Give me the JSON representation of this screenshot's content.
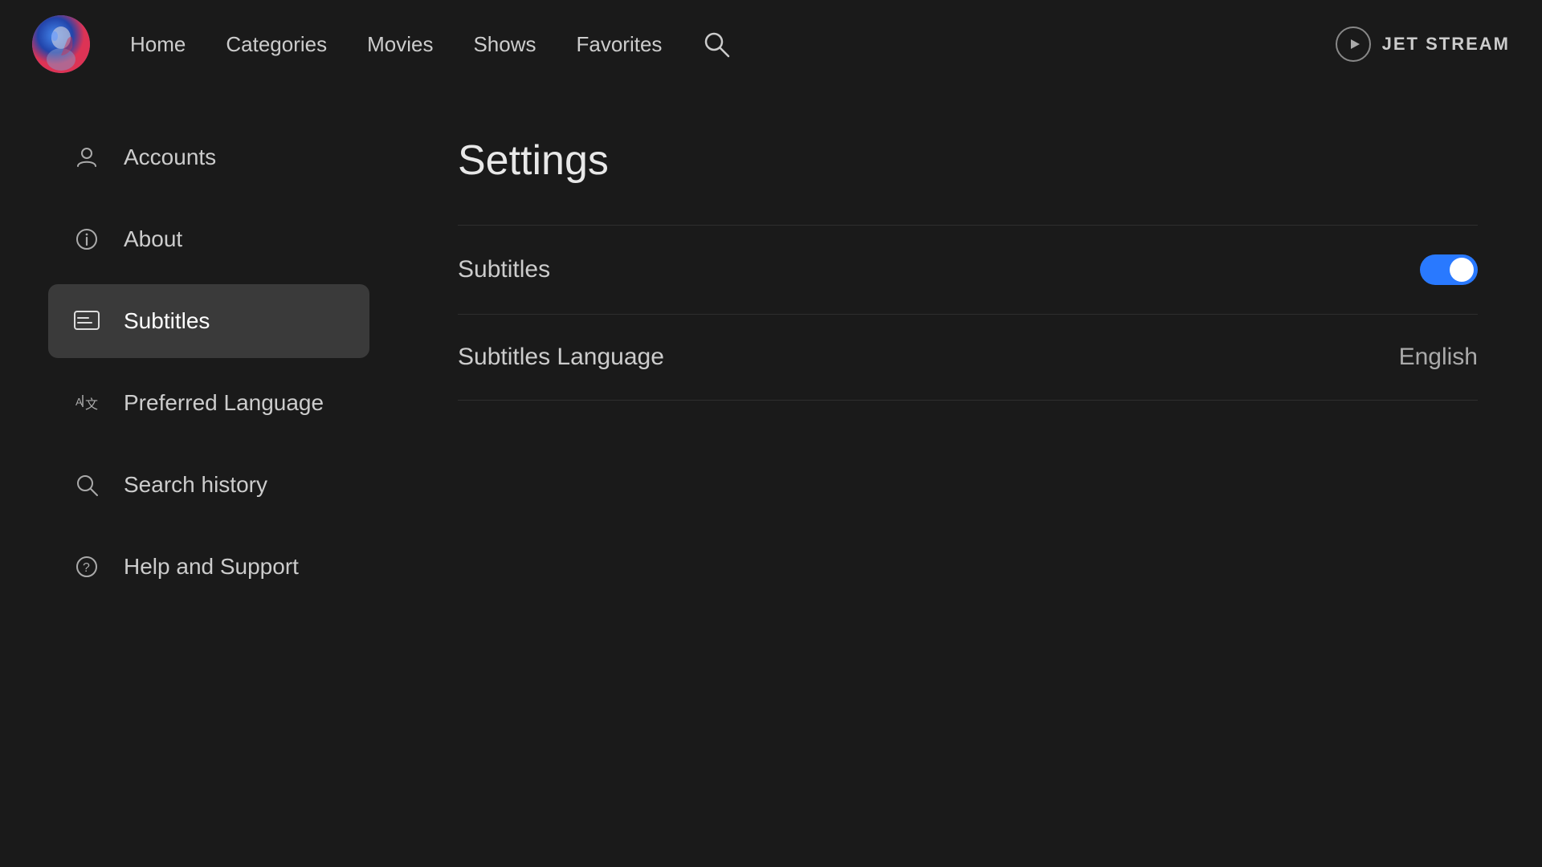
{
  "header": {
    "nav": [
      {
        "label": "Home",
        "id": "home"
      },
      {
        "label": "Categories",
        "id": "categories"
      },
      {
        "label": "Movies",
        "id": "movies"
      },
      {
        "label": "Shows",
        "id": "shows"
      },
      {
        "label": "Favorites",
        "id": "favorites"
      }
    ],
    "brand_name": "JET STREAM"
  },
  "sidebar": {
    "items": [
      {
        "id": "accounts",
        "label": "Accounts",
        "icon": "person"
      },
      {
        "id": "about",
        "label": "About",
        "icon": "info"
      },
      {
        "id": "subtitles",
        "label": "Subtitles",
        "icon": "subtitles",
        "active": true
      },
      {
        "id": "preferred-language",
        "label": "Preferred Language",
        "icon": "translate"
      },
      {
        "id": "search-history",
        "label": "Search history",
        "icon": "search"
      },
      {
        "id": "help-support",
        "label": "Help and Support",
        "icon": "help"
      }
    ]
  },
  "settings": {
    "title": "Settings",
    "rows": [
      {
        "id": "subtitles-toggle",
        "label": "Subtitles",
        "type": "toggle",
        "value": true
      },
      {
        "id": "subtitles-language",
        "label": "Subtitles Language",
        "type": "value",
        "value": "English"
      }
    ]
  },
  "colors": {
    "toggle_on": "#2979ff",
    "accent": "#2979ff",
    "sidebar_active_bg": "#3a3a3a"
  }
}
